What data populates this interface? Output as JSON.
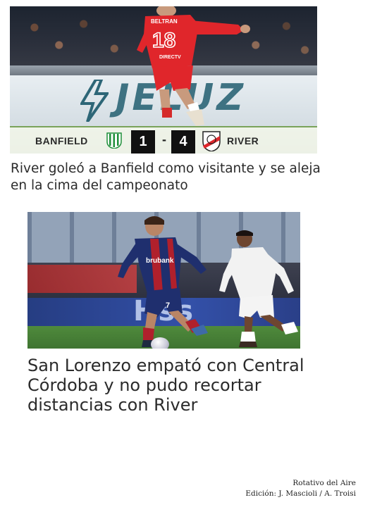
{
  "article_1": {
    "scoreboard": {
      "home_team": "BANFIELD",
      "home_score": "1",
      "separator": "-",
      "away_score": "4",
      "away_team": "RIVER"
    },
    "photo_text": {
      "jersey_name": "BELTRAN",
      "jersey_number": "18",
      "jersey_sponsor": "DIRECTV",
      "ad_board": "JELUZ"
    },
    "headline": "River goleó a Banfield como visitante y se aleja en la cima del campeonato"
  },
  "article_2": {
    "photo_text": {
      "jersey_sponsor": "brubank",
      "jersey_number": "7",
      "ad_board": "Hss"
    },
    "headline": "San Lorenzo empató con Central Córdoba y no pudo recortar distancias con River"
  },
  "footer": {
    "publication": "Rotativo del Aire",
    "credits": "Edición: J. Mascioli / A. Troisi"
  },
  "colors": {
    "river_red": "#e0262b",
    "banfield_green": "#1f8f3a",
    "san_lorenzo_blue": "#1f2f6e",
    "san_lorenzo_red": "#b0202c",
    "headline_text": "#2b2b2b",
    "score_box": "#111111"
  },
  "icons": {
    "home_crest": "banfield-crest-icon",
    "away_crest": "river-plate-crest-icon"
  }
}
